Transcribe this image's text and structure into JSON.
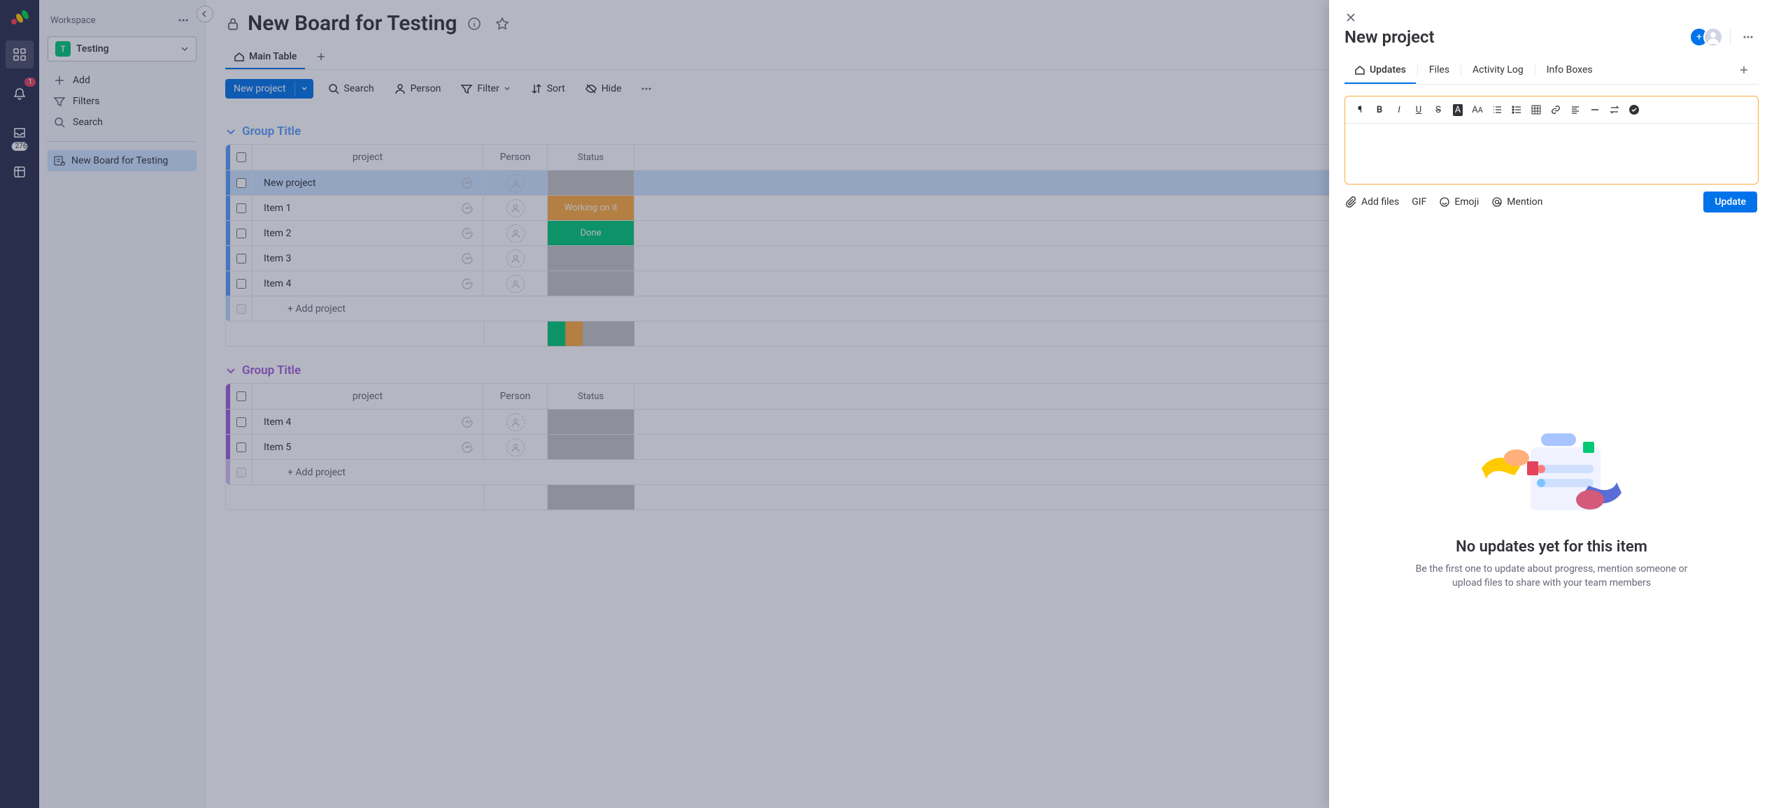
{
  "rail": {
    "notification_count": "1",
    "inbox_count": "276"
  },
  "sidebar": {
    "workspace_label": "Workspace",
    "workspace_initial": "T",
    "workspace_name": "Testing",
    "actions": {
      "add": "Add",
      "filters": "Filters",
      "search": "Search"
    },
    "board_name": "New Board for Testing"
  },
  "board": {
    "title": "New Board for Testing",
    "main_tab": "Main Table",
    "toolbar": {
      "new_item": "New project",
      "search": "Search",
      "person": "Person",
      "filter": "Filter",
      "sort": "Sort",
      "hide": "Hide"
    },
    "columns": {
      "name": "project",
      "person": "Person",
      "status": "Status"
    },
    "groups": [
      {
        "title": "Group Title",
        "color": "blue",
        "items": [
          {
            "name": "New project",
            "status": "",
            "status_class": "st-gray",
            "selected": true
          },
          {
            "name": "Item 1",
            "status": "Working on it",
            "status_class": "st-working"
          },
          {
            "name": "Item 2",
            "status": "Done",
            "status_class": "st-done"
          },
          {
            "name": "Item 3",
            "status": "",
            "status_class": "st-gray"
          },
          {
            "name": "Item 4",
            "status": "",
            "status_class": "st-gray"
          }
        ],
        "add_label": "+ Add project",
        "summary_segments": [
          "st-done",
          "st-working",
          "st-gray",
          "st-gray",
          "st-gray"
        ]
      },
      {
        "title": "Group Title",
        "color": "purple",
        "items": [
          {
            "name": "Item 4",
            "status": "",
            "status_class": "st-gray"
          },
          {
            "name": "Item 5",
            "status": "",
            "status_class": "st-gray"
          }
        ],
        "add_label": "+ Add project",
        "summary_segments": [
          "st-gray"
        ]
      }
    ]
  },
  "panel": {
    "title": "New project",
    "tabs": {
      "updates": "Updates",
      "files": "Files",
      "activity": "Activity Log",
      "info": "Info Boxes"
    },
    "editor_actions": {
      "add_files": "Add files",
      "gif": "GIF",
      "emoji": "Emoji",
      "mention": "Mention",
      "update": "Update"
    },
    "empty": {
      "title": "No updates yet for this item",
      "subtitle": "Be the first one to update about progress, mention someone or upload files to share with your team members"
    }
  }
}
